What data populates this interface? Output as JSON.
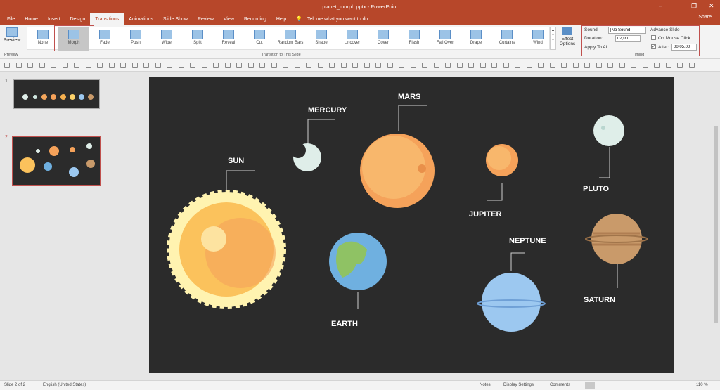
{
  "window": {
    "title": "planet_morph.pptx - PowerPoint",
    "share": "Share"
  },
  "tabs": [
    "File",
    "Home",
    "Insert",
    "Design",
    "Transitions",
    "Animations",
    "Slide Show",
    "Review",
    "View",
    "Recording",
    "Help"
  ],
  "tell_me": "Tell me what you want to do",
  "ribbon": {
    "preview_label": "Preview",
    "preview_group": "Preview",
    "transitions": [
      "None",
      "Morph",
      "Fade",
      "Push",
      "Wipe",
      "Split",
      "Reveal",
      "Cut",
      "Random Bars",
      "Shape",
      "Uncover",
      "Cover",
      "Flash",
      "Fall Over",
      "Drape",
      "Curtains",
      "Wind"
    ],
    "selected": "Morph",
    "transition_group": "Transition to This Slide",
    "effect_options": "Effect Options",
    "timing": {
      "sound_label": "Sound:",
      "sound_value": "[No Sound]",
      "duration_label": "Duration:",
      "duration_value": "02,00",
      "apply_all": "Apply To All",
      "advance_label": "Advance Slide",
      "on_click": "On Mouse Click",
      "on_click_checked": false,
      "after_label": "After:",
      "after_value": "00:05,00",
      "after_checked": true,
      "group": "Timing"
    }
  },
  "thumbnails": [
    {
      "num": "1"
    },
    {
      "num": "2"
    }
  ],
  "slide": {
    "labels": {
      "sun": "SUN",
      "mercury": "MERCURY",
      "mars": "MARS",
      "jupiter": "JUPITER",
      "pluto": "PLUTO",
      "earth": "EARTH",
      "neptune": "NEPTUNE",
      "saturn": "SATURN"
    }
  },
  "status": {
    "slide": "Slide 2 of 2",
    "language": "English (United States)",
    "notes": "Notes",
    "display": "Display Settings",
    "comments": "Comments",
    "zoom": "110 %"
  },
  "colors": {
    "accent": "#b7472a",
    "highlight": "#c0504d",
    "slide_bg": "#2b2b2b"
  }
}
